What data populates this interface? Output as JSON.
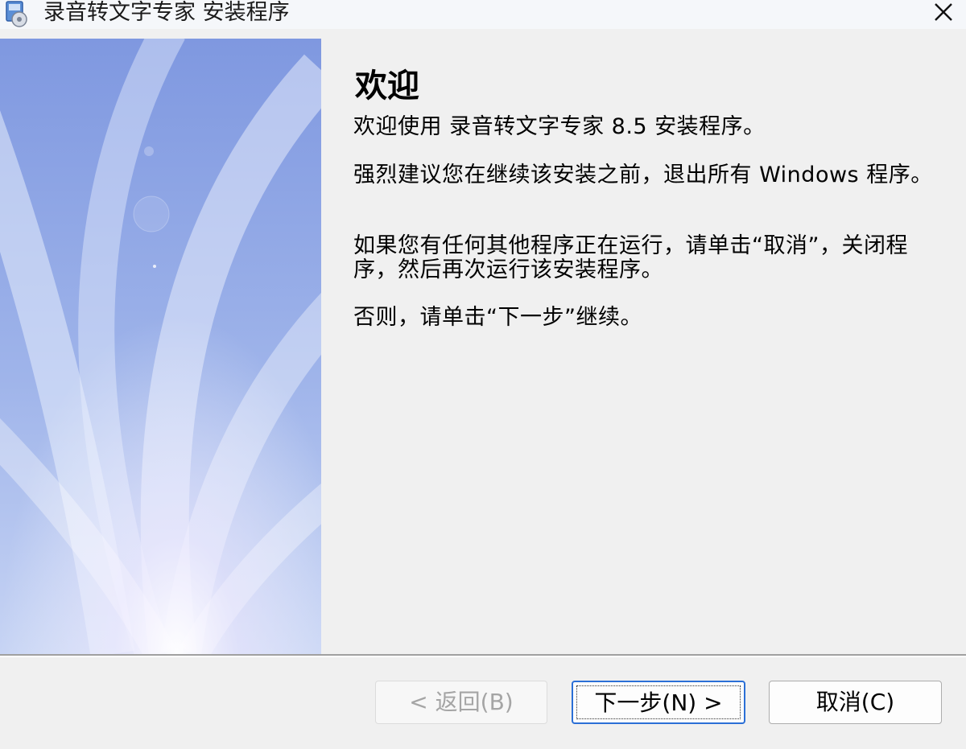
{
  "window": {
    "title": "录音转文字专家 安装程序",
    "close_glyph": "✕"
  },
  "content": {
    "heading": "欢迎",
    "paragraphs": [
      "欢迎使用 录音转文字专家 8.5 安装程序。",
      "强烈建议您在继续该安装之前，退出所有 Windows 程序。",
      "如果您有任何其他程序正在运行，请单击“取消”，关闭程序，然后再次运行该安装程序。",
      "否则，请单击“下一步”继续。"
    ]
  },
  "buttons": {
    "back_label": "< 返回(B)",
    "next_label": "下一步(N) >",
    "cancel_label": "取消(C)"
  },
  "colors": {
    "banner_base": "#8fa6e2",
    "banner_light": "#dfe8fb",
    "focus_blue": "#2b6fd6"
  },
  "icons": {
    "title": "installer-disc-icon",
    "close": "close-icon"
  }
}
